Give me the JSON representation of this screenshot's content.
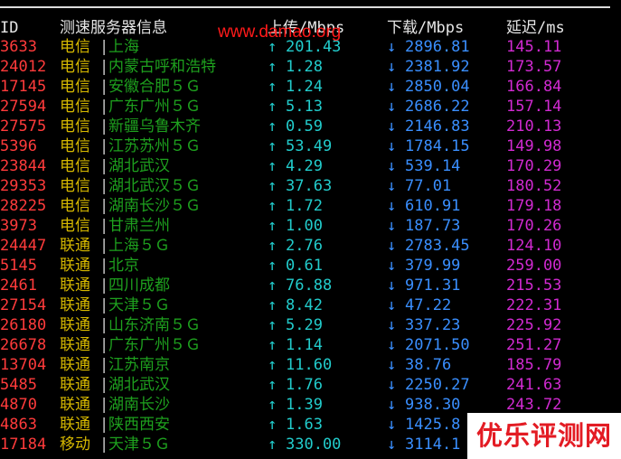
{
  "header": {
    "id": "ID",
    "node": "测速服务器信息",
    "upload": "上传/Mbps",
    "download": "下载/Mbps",
    "latency": "延迟/ms"
  },
  "up_arrow": "↑",
  "down_arrow": "↓",
  "separator": "|",
  "rows": [
    {
      "id": "3633",
      "isp": "电信",
      "location": "上海",
      "upload": "201.43",
      "download": "2896.81",
      "latency": "145.11"
    },
    {
      "id": "24012",
      "isp": "电信",
      "location": "内蒙古呼和浩特",
      "upload": "1.28",
      "download": "2381.92",
      "latency": "173.57"
    },
    {
      "id": "17145",
      "isp": "电信",
      "location": "安徽合肥５Ｇ",
      "upload": "1.24",
      "download": "2850.04",
      "latency": "166.84"
    },
    {
      "id": "27594",
      "isp": "电信",
      "location": "广东广州５Ｇ",
      "upload": "5.13",
      "download": "2686.22",
      "latency": "157.14"
    },
    {
      "id": "27575",
      "isp": "电信",
      "location": "新疆乌鲁木齐",
      "upload": "0.59",
      "download": "2146.83",
      "latency": "210.13"
    },
    {
      "id": "5396",
      "isp": "电信",
      "location": "江苏苏州５Ｇ",
      "upload": "53.49",
      "download": "1784.15",
      "latency": "149.98"
    },
    {
      "id": "23844",
      "isp": "电信",
      "location": "湖北武汉",
      "upload": "4.29",
      "download": "539.14",
      "latency": "170.29"
    },
    {
      "id": "29353",
      "isp": "电信",
      "location": "湖北武汉５Ｇ",
      "upload": "37.63",
      "download": "77.01",
      "latency": "180.52"
    },
    {
      "id": "28225",
      "isp": "电信",
      "location": "湖南长沙５Ｇ",
      "upload": "1.72",
      "download": "610.91",
      "latency": "179.18"
    },
    {
      "id": "3973",
      "isp": "电信",
      "location": "甘肃兰州",
      "upload": "1.00",
      "download": "187.73",
      "latency": "170.26"
    },
    {
      "id": "24447",
      "isp": "联通",
      "location": "上海５Ｇ",
      "upload": "2.76",
      "download": "2783.45",
      "latency": "124.10"
    },
    {
      "id": "5145",
      "isp": "联通",
      "location": "北京",
      "upload": "0.61",
      "download": "379.99",
      "latency": "259.00"
    },
    {
      "id": "2461",
      "isp": "联通",
      "location": "四川成都",
      "upload": "76.88",
      "download": "971.31",
      "latency": "215.53"
    },
    {
      "id": "27154",
      "isp": "联通",
      "location": "天津５Ｇ",
      "upload": "8.42",
      "download": "47.22",
      "latency": "222.31"
    },
    {
      "id": "26180",
      "isp": "联通",
      "location": "山东济南５Ｇ",
      "upload": "5.29",
      "download": "337.23",
      "latency": "225.92"
    },
    {
      "id": "26678",
      "isp": "联通",
      "location": "广东广州５Ｇ",
      "upload": "1.14",
      "download": "2071.50",
      "latency": "251.27"
    },
    {
      "id": "13704",
      "isp": "联通",
      "location": "江苏南京",
      "upload": "11.60",
      "download": "38.76",
      "latency": "185.79"
    },
    {
      "id": "5485",
      "isp": "联通",
      "location": "湖北武汉",
      "upload": "1.76",
      "download": "2250.27",
      "latency": "241.63"
    },
    {
      "id": "4870",
      "isp": "联通",
      "location": "湖南长沙",
      "upload": "1.39",
      "download": "938.30",
      "latency": "243.72"
    },
    {
      "id": "4863",
      "isp": "联通",
      "location": "陕西西安",
      "upload": "1.63",
      "download": "1425.8",
      "latency": ""
    },
    {
      "id": "17184",
      "isp": "移动",
      "location": "天津５Ｇ",
      "upload": "330.00",
      "download": "3114.1",
      "latency": ""
    }
  ],
  "watermark": "www.damao.org",
  "badge": "优乐评测网"
}
